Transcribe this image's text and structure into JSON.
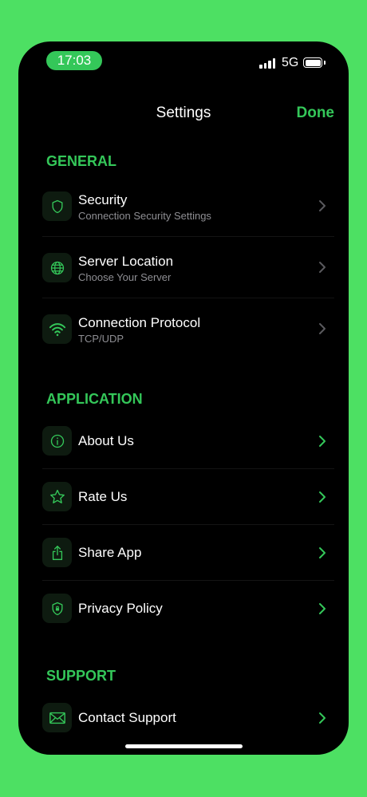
{
  "status_bar": {
    "time": "17:03",
    "network": "5G"
  },
  "nav": {
    "title": "Settings",
    "done_label": "Done"
  },
  "sections": {
    "general": {
      "header": "GENERAL",
      "items": [
        {
          "title": "Security",
          "subtitle": "Connection Security Settings",
          "icon": "shield-icon"
        },
        {
          "title": "Server Location",
          "subtitle": "Choose Your Server",
          "icon": "globe-icon"
        },
        {
          "title": "Connection Protocol",
          "subtitle": "TCP/UDP",
          "icon": "wifi-icon"
        }
      ]
    },
    "application": {
      "header": "APPLICATION",
      "items": [
        {
          "title": "About Us",
          "icon": "info-icon"
        },
        {
          "title": "Rate Us",
          "icon": "star-icon"
        },
        {
          "title": "Share App",
          "icon": "share-icon"
        },
        {
          "title": "Privacy Policy",
          "icon": "privacy-shield-icon"
        }
      ]
    },
    "support": {
      "header": "SUPPORT",
      "items": [
        {
          "title": "Contact Support",
          "icon": "envelope-icon"
        }
      ]
    }
  },
  "colors": {
    "accent": "#34c759",
    "page_background": "#4de063",
    "screen_background": "#000000",
    "icon_tile": "#0e1b10",
    "subtitle": "#8e8e93",
    "chevron_muted": "#5a5a5e"
  }
}
